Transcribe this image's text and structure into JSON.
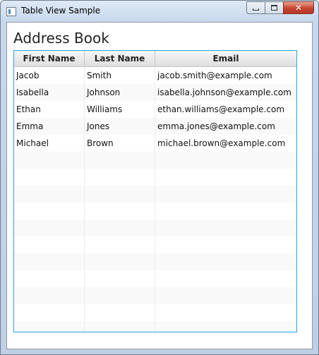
{
  "window": {
    "title": "Table View Sample"
  },
  "heading": "Address Book",
  "table": {
    "columns": [
      "First Name",
      "Last Name",
      "Email"
    ],
    "rows": [
      [
        "Jacob",
        "Smith",
        "jacob.smith@example.com"
      ],
      [
        "Isabella",
        "Johnson",
        "isabella.johnson@example.com"
      ],
      [
        "Ethan",
        "Williams",
        "ethan.williams@example.com"
      ],
      [
        "Emma",
        "Jones",
        "emma.jones@example.com"
      ],
      [
        "Michael",
        "Brown",
        "michael.brown@example.com"
      ]
    ]
  },
  "icons": {
    "minimize": "minimize-icon",
    "maximize": "maximize-icon",
    "close": "close-icon",
    "app": "app-icon"
  },
  "colors": {
    "table_focus_border": "#29a6e1",
    "close_button": "#c6412c"
  }
}
